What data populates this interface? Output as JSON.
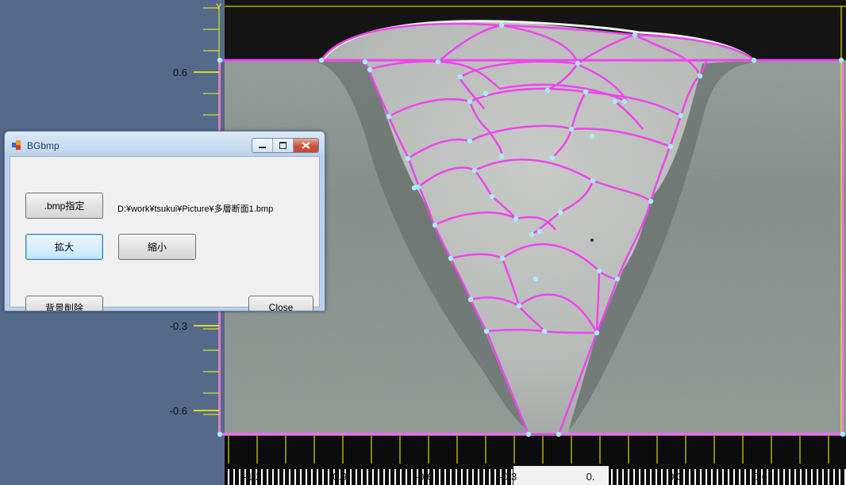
{
  "colors": {
    "desktop": "#556a8a",
    "contour": "#ee44ee",
    "node": "#a6eef5",
    "axis": "#ffff00"
  },
  "plot": {
    "y_ticks": [
      "0.6",
      "-0.3",
      "-0.6"
    ],
    "x_ticks": [
      "-1.2",
      "-0.9",
      "-0.6",
      "-0.3",
      "0.",
      "0.3",
      "0.6"
    ],
    "y_axis_letter": "Y"
  },
  "dialog": {
    "title": "BGbmp",
    "icon": "app-icon",
    "bmp_button": ".bmp指定",
    "file_path": "D:¥work¥tsukui¥Picture¥多層断面1.bmp",
    "zoom_in_button": "拡大",
    "zoom_out_button": "縮小",
    "bg_delete_button": "背景削除",
    "close_button": "Close",
    "minimize_icon": "minimize-icon",
    "maximize_icon": "maximize-icon",
    "close_icon": "close-icon"
  }
}
